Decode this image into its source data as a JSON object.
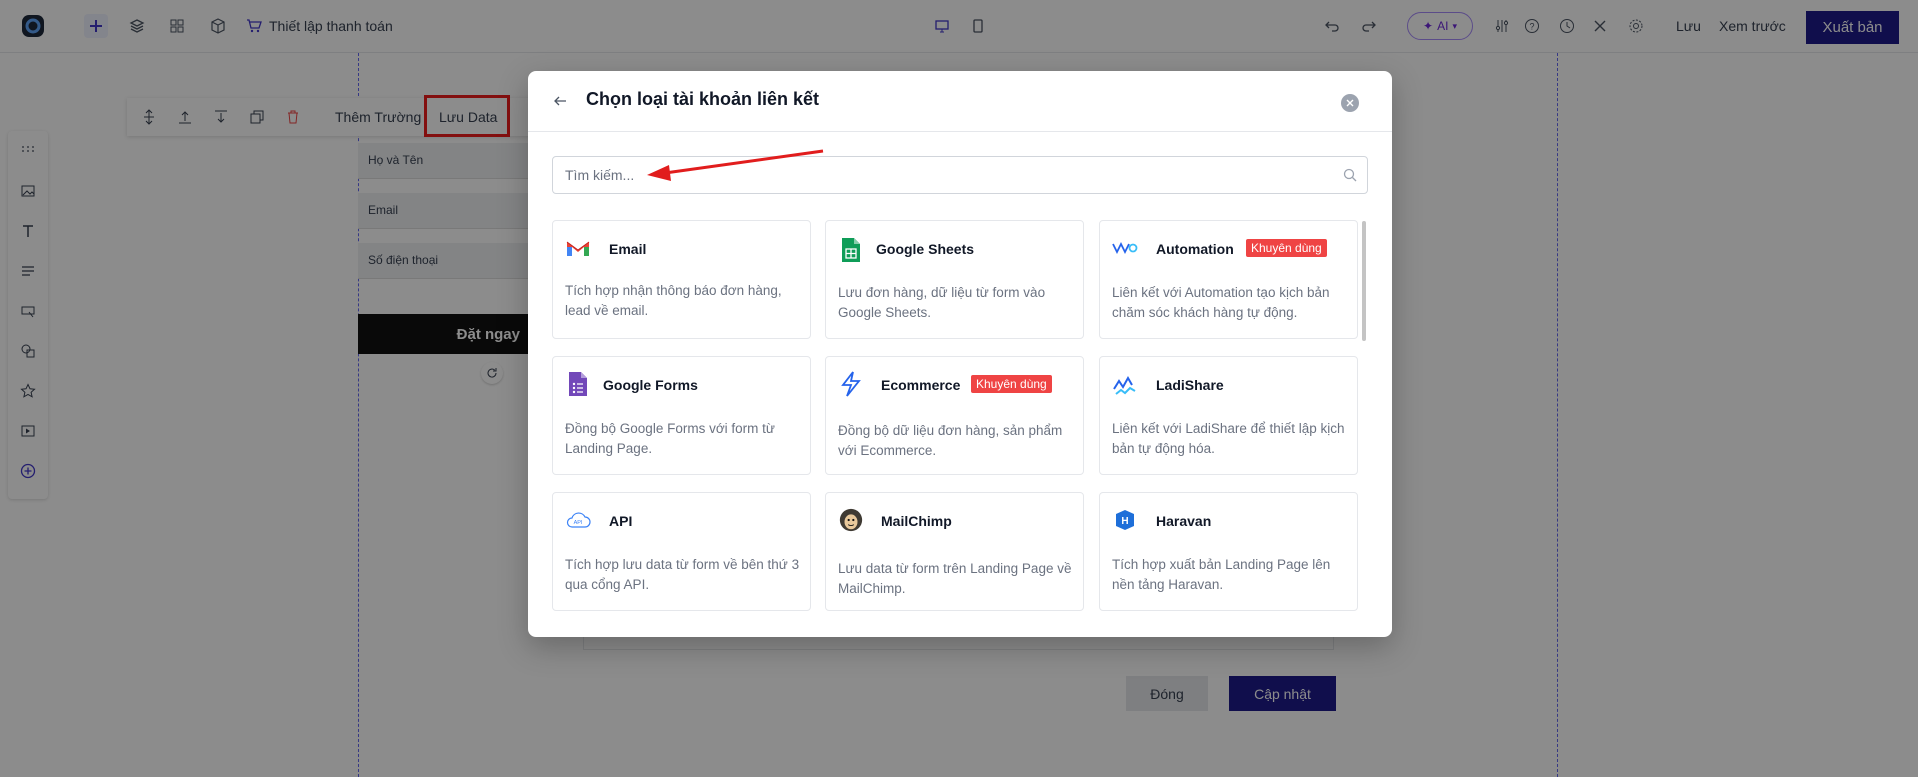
{
  "topbar": {
    "checkout_label": "Thiết lập thanh toán",
    "ai_label": "AI",
    "save_label": "Lưu",
    "preview_label": "Xem trước",
    "publish_label": "Xuất bản",
    "accent_color": "#1e1b8a"
  },
  "element_toolbar": {
    "add_field_label": "Thêm Trường",
    "save_data_label": "Lưu Data"
  },
  "form": {
    "fields": [
      "Họ và Tên",
      "Email",
      "Số điện thoại"
    ],
    "submit_label": "Đặt ngay"
  },
  "background_dialog": {
    "close_label": "Đóng",
    "update_label": "Cập nhật"
  },
  "modal": {
    "title": "Chọn loại tài khoản liên kết",
    "search_placeholder": "Tìm kiếm...",
    "cards": [
      {
        "title": "Email",
        "desc": "Tích hợp nhận thông báo đơn hàng, lead về email.",
        "icon": "gmail-icon",
        "badge": ""
      },
      {
        "title": "Google Sheets",
        "desc": "Lưu đơn hàng, dữ liệu từ form vào Google Sheets.",
        "icon": "google-sheets-icon",
        "badge": ""
      },
      {
        "title": "Automation",
        "desc": "Liên kết với Automation tạo kịch bản chăm sóc khách hàng tự động.",
        "icon": "automation-icon",
        "badge": "Khuyên dùng"
      },
      {
        "title": "Google Forms",
        "desc": "Đồng bộ Google Forms với form từ Landing Page.",
        "icon": "google-forms-icon",
        "badge": ""
      },
      {
        "title": "Ecommerce",
        "desc": "Đồng bộ dữ liệu đơn hàng, sản phẩm với Ecommerce.",
        "icon": "ecommerce-icon",
        "badge": "Khuyên dùng"
      },
      {
        "title": "LadiShare",
        "desc": "Liên kết với LadiShare để thiết lập kịch bản tự động hóa.",
        "icon": "ladishare-icon",
        "badge": ""
      },
      {
        "title": "API",
        "desc": "Tích hợp lưu data từ form về bên thứ 3 qua cổng API.",
        "icon": "api-cloud-icon",
        "badge": ""
      },
      {
        "title": "MailChimp",
        "desc": "Lưu data từ form trên Landing Page về MailChimp.",
        "icon": "mailchimp-icon",
        "badge": ""
      },
      {
        "title": "Haravan",
        "desc": "Tích hợp xuất bản Landing Page lên nền tảng Haravan.",
        "icon": "haravan-icon",
        "badge": ""
      }
    ]
  }
}
